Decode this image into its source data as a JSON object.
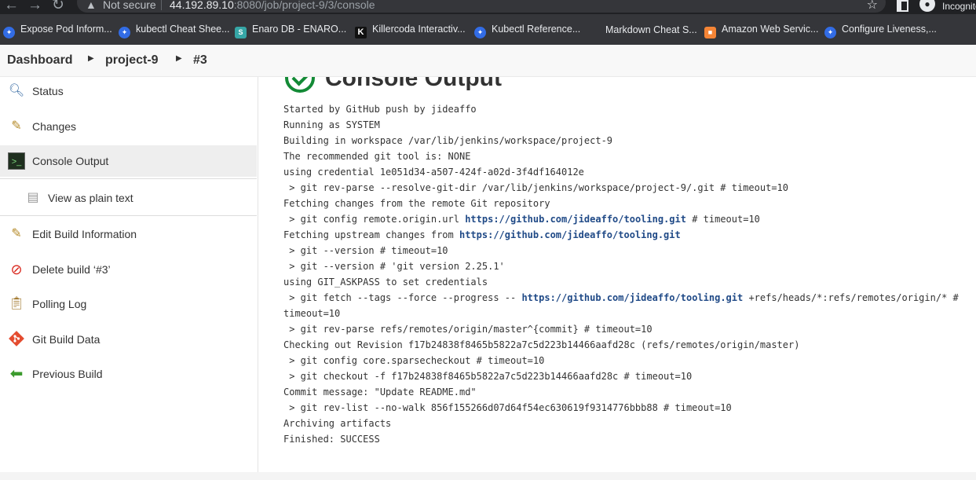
{
  "browser": {
    "not_secure_label": "Not secure",
    "url_host": "44.192.89.10",
    "url_rest": ":8080/job/project-9/3/console",
    "profile_label": "Incognito",
    "nav_icons": [
      "back-arrow-icon",
      "forward-arrow-icon",
      "reload-icon"
    ],
    "bookmarks": [
      {
        "label": "Expose Pod Inform...",
        "icon": "kubernetes-icon"
      },
      {
        "label": "kubectl Cheat Shee...",
        "icon": "kubernetes-icon"
      },
      {
        "label": "Enaro DB - ENARO...",
        "icon": "sharepoint-icon"
      },
      {
        "label": "Killercoda Interactiv...",
        "icon": "killercoda-icon"
      },
      {
        "label": "Kubectl Reference...",
        "icon": "kubernetes-icon"
      },
      {
        "label": "Markdown Cheat S...",
        "icon": "document-icon"
      },
      {
        "label": "Amazon Web Servic...",
        "icon": "aws-cube-icon"
      },
      {
        "label": "Configure Liveness,...",
        "icon": "kubernetes-icon"
      }
    ]
  },
  "breadcrumb": {
    "items": [
      "Dashboard",
      "project-9",
      "#3"
    ]
  },
  "side_panel": {
    "tasks": [
      {
        "label": "Status",
        "icon": "magnifier-icon"
      },
      {
        "label": "Changes",
        "icon": "notepad-icon"
      },
      {
        "label": "Console Output",
        "icon": "terminal-icon"
      },
      {
        "label": "View as plain text",
        "icon": "document-icon"
      },
      {
        "label": "Edit Build Information",
        "icon": "notepad-icon"
      },
      {
        "label": "Delete build ‘#3’",
        "icon": "no-entry-icon"
      },
      {
        "label": "Polling Log",
        "icon": "clipboard-icon"
      },
      {
        "label": "Git Build Data",
        "icon": "git-icon"
      },
      {
        "label": "Previous Build",
        "icon": "left-arrow-icon"
      }
    ]
  },
  "main": {
    "title": "Console Output",
    "status_color": "#138a36",
    "link_url": "https://github.com/jideaffo/tooling.git",
    "console_lines": {
      "l1": "Started by GitHub push by jideaffo",
      "l2": "Running as SYSTEM",
      "l3": "Building in workspace /var/lib/jenkins/workspace/project-9",
      "l4": "The recommended git tool is: NONE",
      "l5": "using credential 1e051d34-a507-424f-a02d-3f4df164012e",
      "l6": " > git rev-parse --resolve-git-dir /var/lib/jenkins/workspace/project-9/.git # timeout=10",
      "l7": "Fetching changes from the remote Git repository",
      "l8_pre": " > git config remote.origin.url ",
      "l8_post": " # timeout=10",
      "l9_pre": "Fetching upstream changes from ",
      "l10": " > git --version # timeout=10",
      "l11": " > git --version # 'git version 2.25.1'",
      "l12": "using GIT_ASKPASS to set credentials",
      "l13_pre": " > git fetch --tags --force --progress -- ",
      "l13_post": " +refs/heads/*:refs/remotes/origin/* #",
      "l14": "timeout=10",
      "l15": " > git rev-parse refs/remotes/origin/master^{commit} # timeout=10",
      "l16": "Checking out Revision f17b24838f8465b5822a7c5d223b14466aafd28c (refs/remotes/origin/master)",
      "l17": " > git config core.sparsecheckout # timeout=10",
      "l18": " > git checkout -f f17b24838f8465b5822a7c5d223b14466aafd28c # timeout=10",
      "l19": "Commit message: \"Update README.md\"",
      "l20": " > git rev-list --no-walk 856f155266d07d64f54ec630619f9314776bbb88 # timeout=10",
      "l21": "Archiving artifacts",
      "l22": "Finished: SUCCESS"
    }
  }
}
